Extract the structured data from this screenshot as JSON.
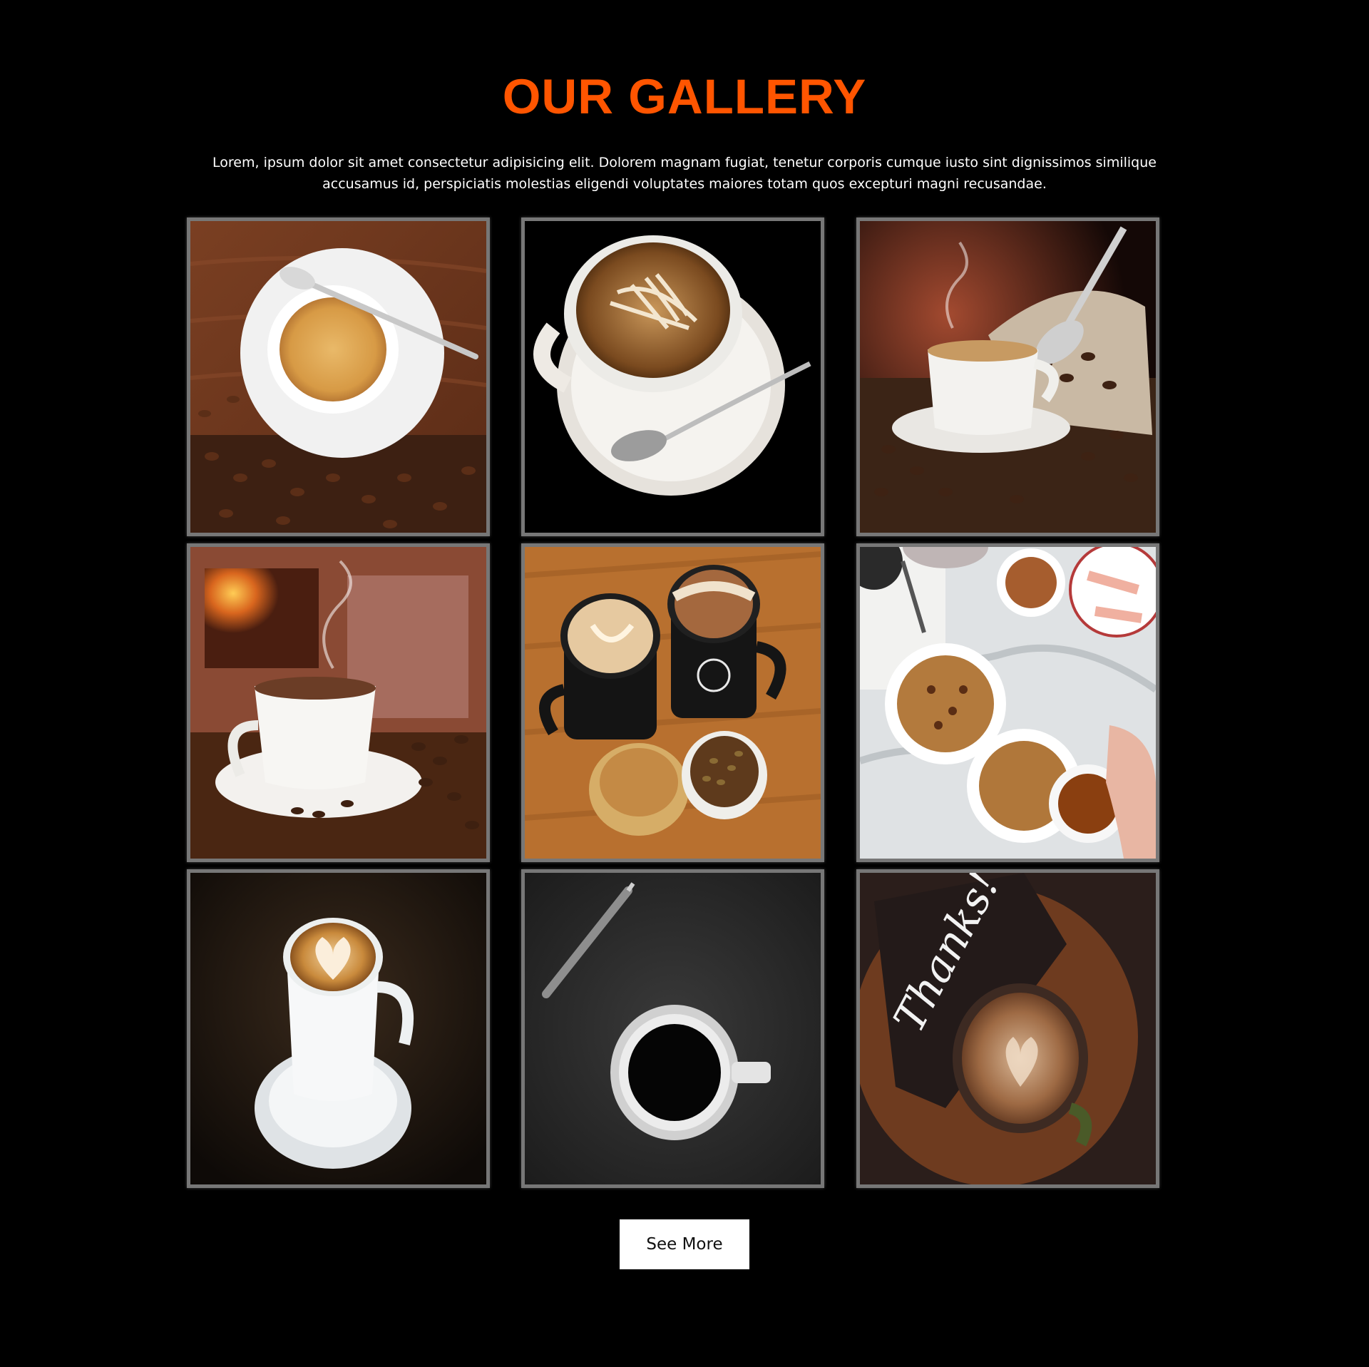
{
  "gallery": {
    "title": "OUR GALLERY",
    "description": "Lorem, ipsum dolor sit amet consectetur adipisicing elit. Dolorem magnam fugiat, tenetur corporis cumque iusto sint dignissimos similique accusamus id, perspiciatis molestias eligendi voluptates maiores totam quos excepturi magni recusandae.",
    "images": [
      {
        "name": "espresso-saucer-coffee-beans"
      },
      {
        "name": "latte-art-cup-black-background"
      },
      {
        "name": "coffee-cup-bean-sack-scoop"
      },
      {
        "name": "coffee-cup-by-fireplace"
      },
      {
        "name": "two-lattes-and-muffins"
      },
      {
        "name": "oatmeal-bowls-with-coffee"
      },
      {
        "name": "latte-art-cup-dark"
      },
      {
        "name": "black-coffee-with-pencil"
      },
      {
        "name": "thanks-card-cappuccino"
      }
    ],
    "thanks_lettering": "Thanks!",
    "see_more_label": "See More",
    "colors": {
      "background": "#000000",
      "title": "#ff5500",
      "text": "#ffffff",
      "tile_border": "#777777",
      "button_bg": "#ffffff"
    }
  }
}
